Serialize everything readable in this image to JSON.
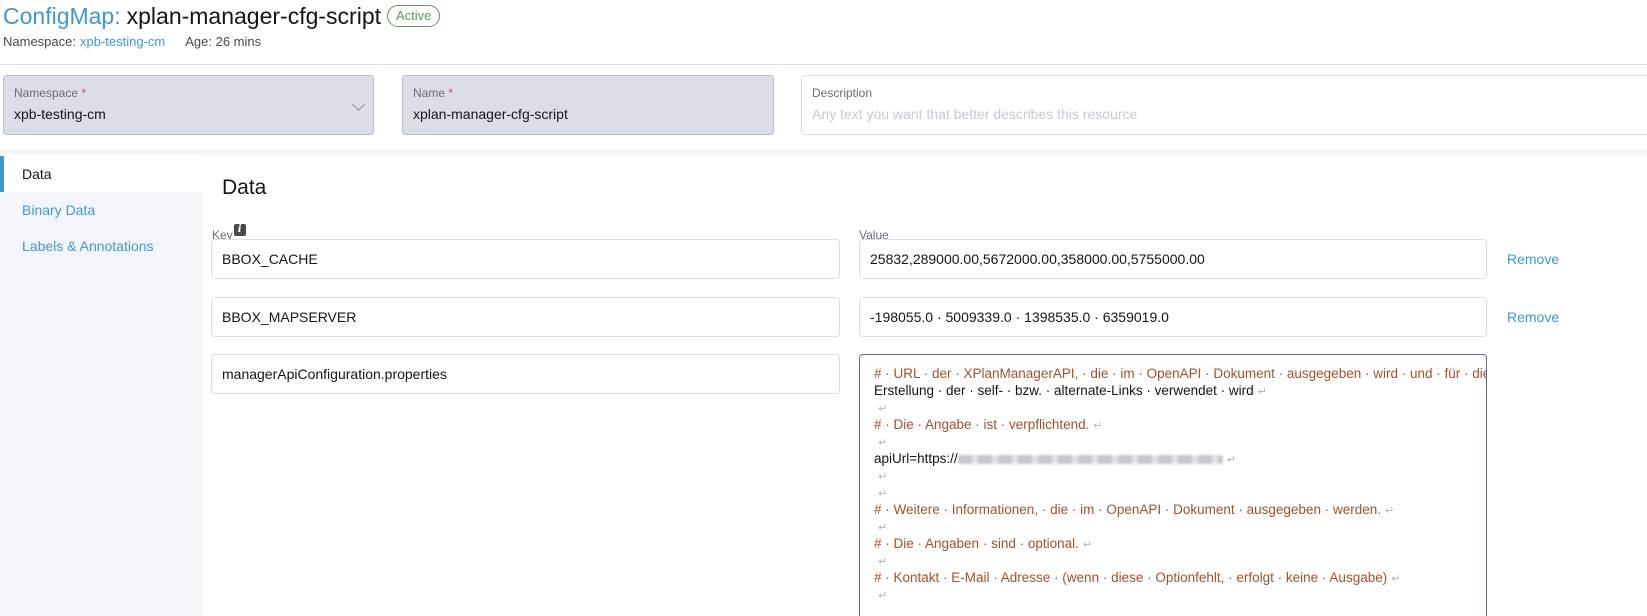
{
  "header": {
    "kind": "ConfigMap:",
    "name": "xplan-manager-cfg-script",
    "status": "Active",
    "namespace_label": "Namespace:",
    "namespace_value": "xpb-testing-cm",
    "age": "Age: 26 mins"
  },
  "form": {
    "namespace": {
      "label": "Namespace",
      "required_mark": "*",
      "value": "xpb-testing-cm"
    },
    "name": {
      "label": "Name",
      "required_mark": "*",
      "value": "xplan-manager-cfg-script"
    },
    "description": {
      "label": "Description",
      "placeholder": "Any text you want that better describes this resource"
    }
  },
  "sidebar": {
    "tabs": [
      {
        "label": "Data",
        "active": true
      },
      {
        "label": "Binary Data",
        "active": false
      },
      {
        "label": "Labels & Annotations",
        "active": false
      }
    ]
  },
  "data_section": {
    "title": "Data",
    "key_header": "Key",
    "value_header": "Value",
    "remove_label": "Remove",
    "rows": [
      {
        "key": "BBOX_CACHE",
        "value": "25832,289000.00,5672000.00,358000.00,5755000.00"
      },
      {
        "key": "BBOX_MAPSERVER",
        "value": "-198055.0 · 5009339.0 · 1398535.0 · 6359019.0"
      },
      {
        "key": "managerApiConfiguration.properties"
      }
    ],
    "editor_lines": [
      {
        "text": "# · URL · der · XPlanManagerAPI, · die · im · OpenAPI · Dokument · ausgegeben · wird · und · für · die",
        "kind": "comment"
      },
      {
        "text": "Erstellung · der · self- · bzw. · alternate-Links · verwendet · wird",
        "kind": "plain"
      },
      {
        "text": "",
        "kind": "plain"
      },
      {
        "text": "# · Die · Angabe · ist · verpflichtend.",
        "kind": "comment"
      },
      {
        "text": "",
        "kind": "plain"
      },
      {
        "text": "apiUrl=https://",
        "kind": "plain",
        "redacted": true
      },
      {
        "text": "",
        "kind": "plain"
      },
      {
        "text": "",
        "kind": "plain"
      },
      {
        "text": "# · Weitere · Informationen, · die · im · OpenAPI · Dokument · ausgegeben · werden.",
        "kind": "comment"
      },
      {
        "text": "",
        "kind": "plain"
      },
      {
        "text": "# · Die · Angaben · sind · optional.",
        "kind": "comment"
      },
      {
        "text": "",
        "kind": "plain"
      },
      {
        "text": "# · Kontakt · E-Mail · Adresse · (wenn · diese · Optionfehlt, · erfolgt · keine · Ausgabe)",
        "kind": "comment"
      },
      {
        "text": "",
        "kind": "plain"
      }
    ]
  },
  "colors": {
    "accent": "#3d98d3",
    "active_badge": "#5d995d",
    "comment": "#a0522d"
  }
}
